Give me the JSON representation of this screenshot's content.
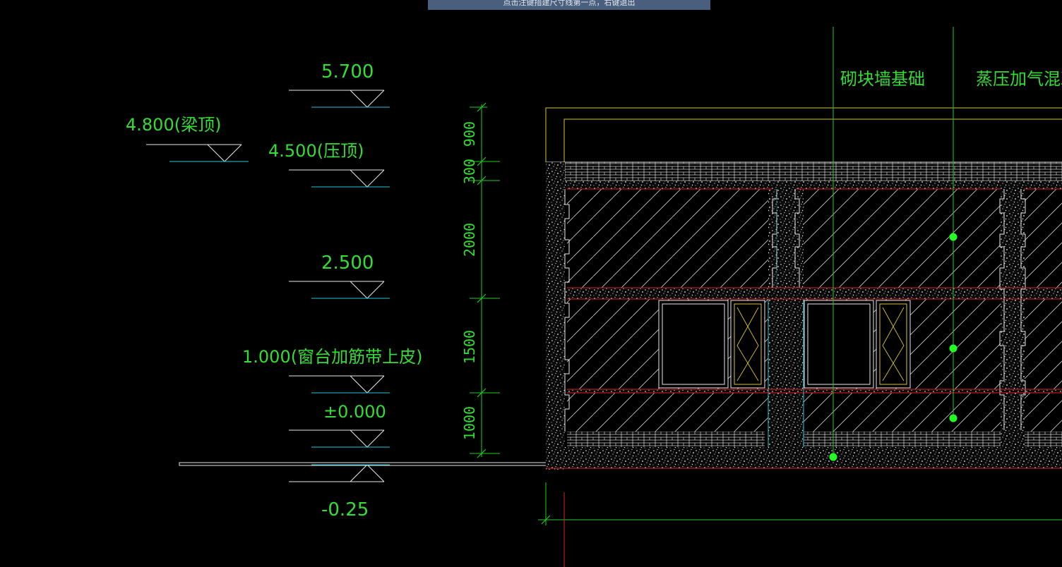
{
  "titlebar": {
    "text": "点击注键措建尺寸线第一点，右键退出"
  },
  "elevations": {
    "e_5700": "5.700",
    "e_4800": "4.800(梁顶)",
    "e_4500": "4.500(压顶)",
    "e_2500": "2.500",
    "e_1000": "1.000(窗台加筋带上皮)",
    "e_0000": "±0.000",
    "e_m025": "-0.25"
  },
  "dimensions": {
    "d900": "900",
    "d300": "300",
    "d2000": "2000",
    "d1500": "1500",
    "d1000": "1000"
  },
  "labels": {
    "block_wall_foundation": "砌块墙基础",
    "aerated_concrete": "蒸压加气混凝土砌"
  },
  "colors": {
    "background": "#000000",
    "text_green": "#33dd33",
    "dim_green": "#22cc22",
    "cyan": "#22c8d8",
    "red": "#dd2222",
    "yellow": "#d9c23a",
    "white": "#e8e8e8",
    "grip": "#22ff22"
  }
}
